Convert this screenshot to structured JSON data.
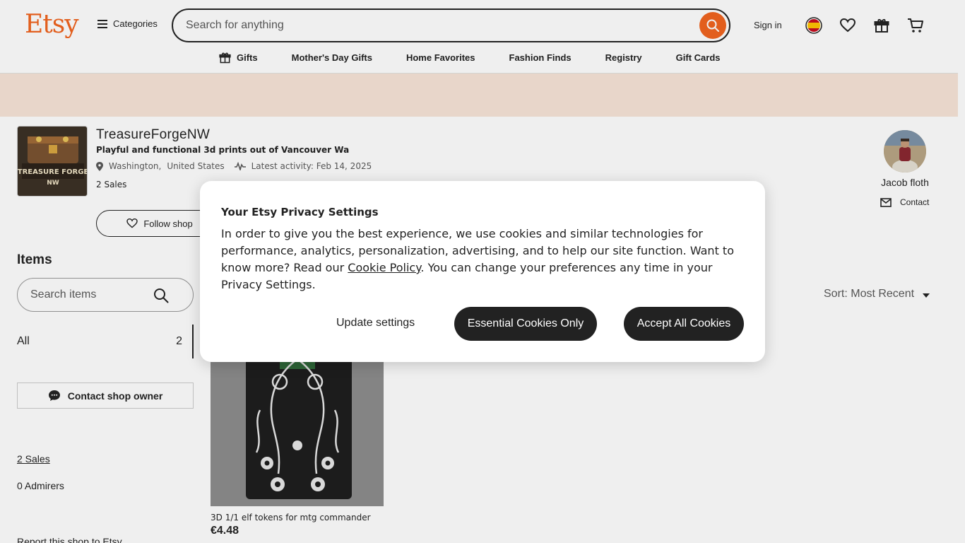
{
  "header": {
    "logo": "Etsy",
    "categories_label": "Categories",
    "search_placeholder": "Search for anything",
    "signin_label": "Sign in"
  },
  "nav": {
    "items": [
      "Gifts",
      "Mother's Day Gifts",
      "Home Favorites",
      "Fashion Finds",
      "Registry",
      "Gift Cards"
    ]
  },
  "shop": {
    "name": "TreasureForgeNW",
    "tagline": "Playful and functional 3d prints out of Vancouver Wa",
    "location_state": "Washington,",
    "location_country": "United States",
    "latest_activity": "Latest activity: Feb 14, 2025",
    "sales": "2 Sales",
    "follow_label": "Follow shop",
    "logo_text": "TREASURE FORGE",
    "logo_subtext": "NW"
  },
  "owner": {
    "name": "Jacob floth",
    "contact_label": "Contact"
  },
  "sidebar": {
    "items_title": "Items",
    "search_placeholder": "Search items",
    "all_label": "All",
    "all_count": "2",
    "contact_owner_label": "Contact shop owner",
    "sales_link": "2 Sales",
    "admirers": "0 Admirers",
    "report": "Report this shop to Etsy"
  },
  "sort": {
    "label": "Sort: Most Recent"
  },
  "listing": {
    "title": "3D 1/1 elf tokens for mtg commander",
    "price": "€4.48"
  },
  "privacy_modal": {
    "title": "Your Etsy Privacy Settings",
    "body_before_link": "In order to give you the best experience, we use cookies and similar technologies for performance, analytics, personalization, advertising, and to help our site function. Want to know more? Read our ",
    "link_text": "Cookie Policy",
    "body_after_link": ". You can change your preferences any time in your Privacy Settings.",
    "update_label": "Update settings",
    "essential_label": "Essential Cookies Only",
    "accept_label": "Accept All Cookies"
  },
  "colors": {
    "brand_orange": "#f1641e",
    "banner": "#f8e5d8",
    "dark_button": "#222222"
  }
}
